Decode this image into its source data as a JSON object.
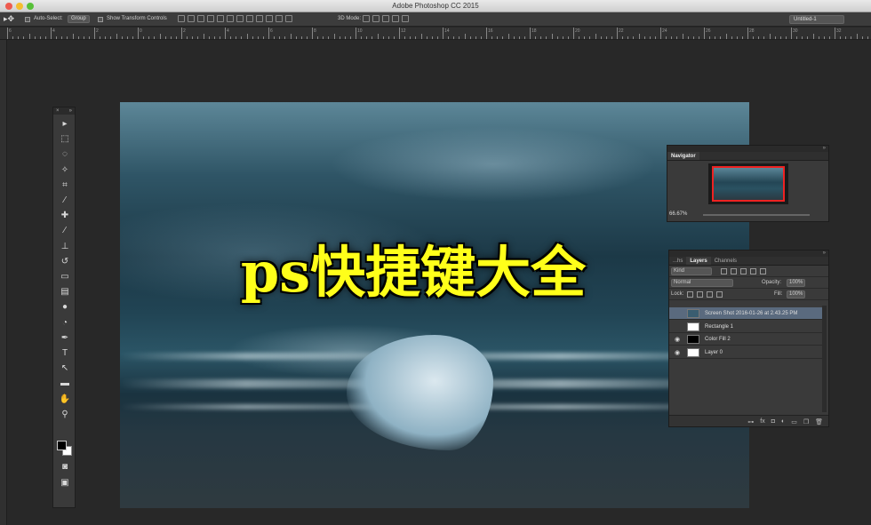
{
  "window": {
    "title": "Adobe Photoshop CC 2015"
  },
  "options_bar": {
    "tool_icon": "move-tool-icon",
    "auto_select_label": "Auto-Select:",
    "auto_select_value": "Group",
    "show_transform_label": "Show Transform Controls",
    "mode_3d_label": "3D Mode:",
    "document_selector": "Untitled-1"
  },
  "ruler": {
    "top_labels": [
      "6",
      "4",
      "2",
      "0",
      "2",
      "4",
      "6",
      "8",
      "10",
      "12",
      "14",
      "16",
      "18",
      "20",
      "22",
      "24",
      "26",
      "28",
      "30",
      "32"
    ],
    "left_labels": [
      "2",
      "4",
      "6",
      "8",
      "10",
      "12",
      "14",
      "16",
      "18",
      "20"
    ]
  },
  "canvas": {
    "overlay_text": "ps快捷键大全",
    "overlay_color": "#ffff1a"
  },
  "toolbox": {
    "header_close": "×",
    "header_collapse": "»",
    "tools": [
      {
        "name": "move-tool-icon",
        "glyph": "▸"
      },
      {
        "name": "marquee-tool-icon",
        "glyph": "⬚"
      },
      {
        "name": "lasso-tool-icon",
        "glyph": "◌"
      },
      {
        "name": "quick-select-tool-icon",
        "glyph": "✧"
      },
      {
        "name": "crop-tool-icon",
        "glyph": "⌗"
      },
      {
        "name": "eyedropper-tool-icon",
        "glyph": "⁄"
      },
      {
        "name": "healing-brush-tool-icon",
        "glyph": "✚"
      },
      {
        "name": "brush-tool-icon",
        "glyph": "∕"
      },
      {
        "name": "clone-stamp-tool-icon",
        "glyph": "⊥"
      },
      {
        "name": "history-brush-tool-icon",
        "glyph": "↺"
      },
      {
        "name": "eraser-tool-icon",
        "glyph": "▭"
      },
      {
        "name": "gradient-tool-icon",
        "glyph": "▤"
      },
      {
        "name": "blur-tool-icon",
        "glyph": "●"
      },
      {
        "name": "dodge-tool-icon",
        "glyph": "◔"
      },
      {
        "name": "pen-tool-icon",
        "glyph": "✒"
      },
      {
        "name": "type-tool-icon",
        "glyph": "T"
      },
      {
        "name": "path-select-tool-icon",
        "glyph": "↖"
      },
      {
        "name": "rectangle-tool-icon",
        "glyph": "▬"
      },
      {
        "name": "hand-tool-icon",
        "glyph": "✋"
      },
      {
        "name": "zoom-tool-icon",
        "glyph": "⚲"
      }
    ],
    "extra": [
      {
        "name": "quick-mask-icon",
        "glyph": "◙"
      },
      {
        "name": "screen-mode-icon",
        "glyph": "▣"
      }
    ]
  },
  "navigator": {
    "tab_label": "Navigator",
    "zoom_value": "66.67%"
  },
  "layers": {
    "tabs": [
      "Layers",
      "Channels"
    ],
    "tab_prefix": "...hs",
    "kind_value": "Kind",
    "blend_mode_value": "Normal",
    "opacity_label": "Opacity:",
    "opacity_value": "100%",
    "lock_label": "Lock:",
    "fill_label": "Fill:",
    "fill_value": "100%",
    "items": [
      {
        "name": "Screen Shot 2016-01-26 at 2.43.25 PM",
        "visible": false,
        "selected": true,
        "thumb": "#3a5d70"
      },
      {
        "name": "Rectangle 1",
        "visible": false,
        "selected": false,
        "thumb": "#ffffff"
      },
      {
        "name": "Color Fill 2",
        "visible": true,
        "selected": false,
        "thumb": "#000000"
      },
      {
        "name": "Layer 0",
        "visible": true,
        "selected": false,
        "thumb": "#ffffff"
      }
    ],
    "footer_icons": [
      "link-icon",
      "fx-icon",
      "mask-icon",
      "adjustment-icon",
      "group-icon",
      "new-layer-icon",
      "trash-icon"
    ]
  }
}
